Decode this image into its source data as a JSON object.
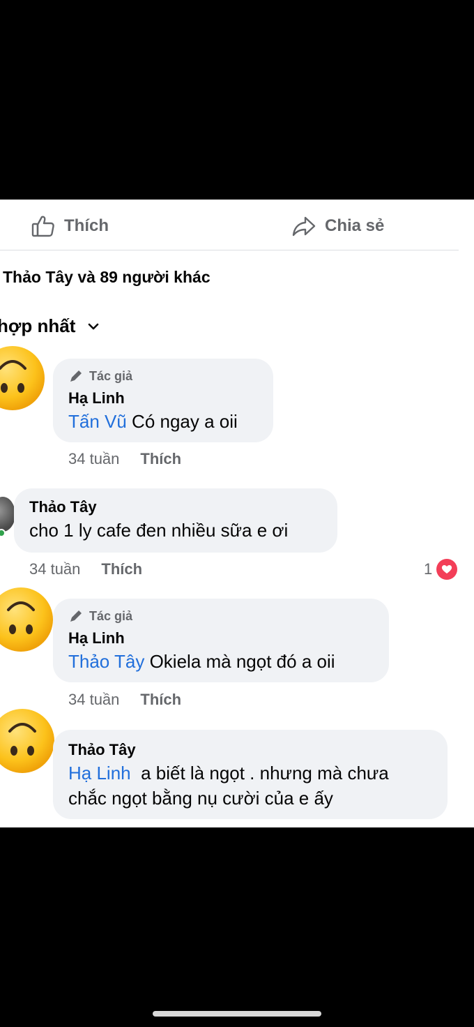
{
  "actions": {
    "like_label": "Thích",
    "share_label": "Chia sẻ"
  },
  "reactions_summary": "Thảo Tây và 89 người khác",
  "sort": {
    "label": "hợp nhất"
  },
  "comments": [
    {
      "badge": "Tác giả",
      "author": "Hạ Linh",
      "mention": "Tấn Vũ",
      "text": " Có ngay a oii",
      "time": "34 tuần",
      "like_label": "Thích"
    },
    {
      "author": "Thảo Tây",
      "text": "cho 1 ly cafe đen nhiều sữa e ơi",
      "time": "34 tuần",
      "like_label": "Thích",
      "reaction_count": "1"
    },
    {
      "badge": "Tác giả",
      "author": "Hạ Linh",
      "mention": "Thảo Tây",
      "text": " Okiela mà ngọt đó a oii",
      "time": "34 tuần",
      "like_label": "Thích"
    },
    {
      "author": "Thảo Tây",
      "mention": "Hạ Linh",
      "text_line1": "  a biết là ngọt . nhưng mà chưa",
      "text_line2": "chắc ngọt bằng nụ cười của e ấy"
    }
  ],
  "colors": {
    "mention": "#216fdb",
    "muted": "#65676b",
    "bubble": "#f0f2f5",
    "heart": "#f33e58"
  }
}
